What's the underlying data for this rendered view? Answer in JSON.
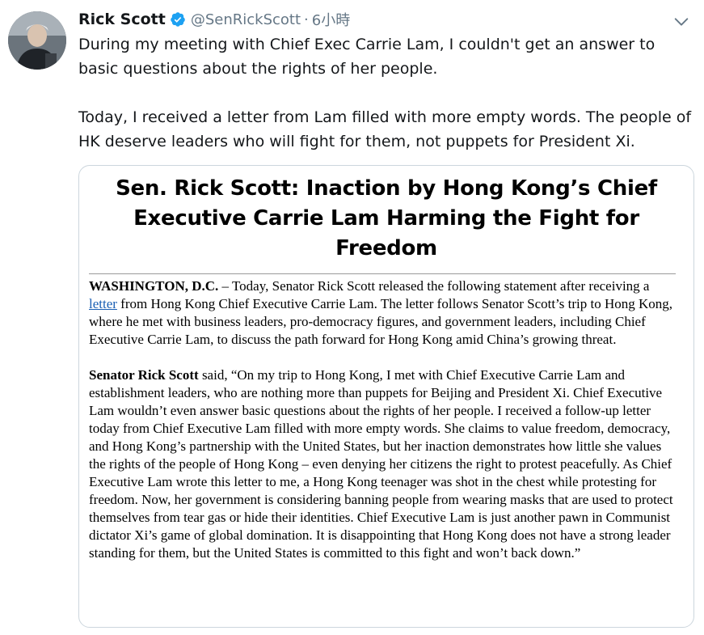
{
  "tweet": {
    "author": {
      "display_name": "Rick Scott",
      "handle": "@SenRickScott",
      "separator": "·",
      "time": "6小時",
      "verified": true,
      "avatar_icon": "avatar-photo"
    },
    "menu_icon": "chevron-down-icon",
    "text_paragraph_1": "During my meeting with Chief Exec Carrie Lam, I couldn't get an answer to basic questions about the rights of her people.",
    "text_paragraph_2": "Today, I received a letter from Lam filled with more empty words. The people of HK deserve leaders who will fight for them, not puppets for President Xi."
  },
  "card": {
    "headline": "Sen. Rick Scott: Inaction by Hong Kong’s Chief Executive Carrie Lam Harming the Fight for Freedom",
    "p1_dateline": "WASHINGTON, D.C.",
    "p1_a": " – Today, Senator Rick Scott released the following statement after receiving a ",
    "p1_link": "letter",
    "p1_b": " from Hong Kong Chief Executive Carrie Lam. The letter follows Senator Scott’s trip to Hong Kong, where he met with business leaders, pro-democracy figures, and government leaders, including Chief Executive Carrie Lam, to discuss the path forward for Hong Kong amid China’s growing threat.",
    "p2_speaker": "Senator Rick Scott",
    "p2_text": " said, “On my trip to Hong Kong, I met with Chief Executive Carrie Lam and establishment leaders, who are nothing more than puppets for Beijing and President Xi. Chief Executive Lam wouldn’t even answer basic questions about the rights of her people. I received a follow-up letter today from Chief Executive Lam filled with more empty words. She claims to value freedom, democracy, and Hong Kong’s partnership with the United States, but her inaction demonstrates how little she values the rights of the people of Hong Kong – even denying her citizens the right to protest peacefully. As Chief Executive Lam wrote this letter to me, a Hong Kong teenager was shot in the chest while protesting for freedom. Now, her government is considering banning people from wearing masks that are used to protect themselves from tear gas or hide their identities. Chief Executive Lam is just another pawn in Communist dictator Xi’s game of global domination. It is disappointing that Hong Kong does not have a strong leader standing for them, but the United States is committed to this fight and won’t back down.”"
  },
  "colors": {
    "text_primary": "#14171a",
    "text_secondary": "#657786",
    "verified_badge": "#1da1f2",
    "card_border": "#ccd6dd",
    "link": "#1a5fb4"
  }
}
